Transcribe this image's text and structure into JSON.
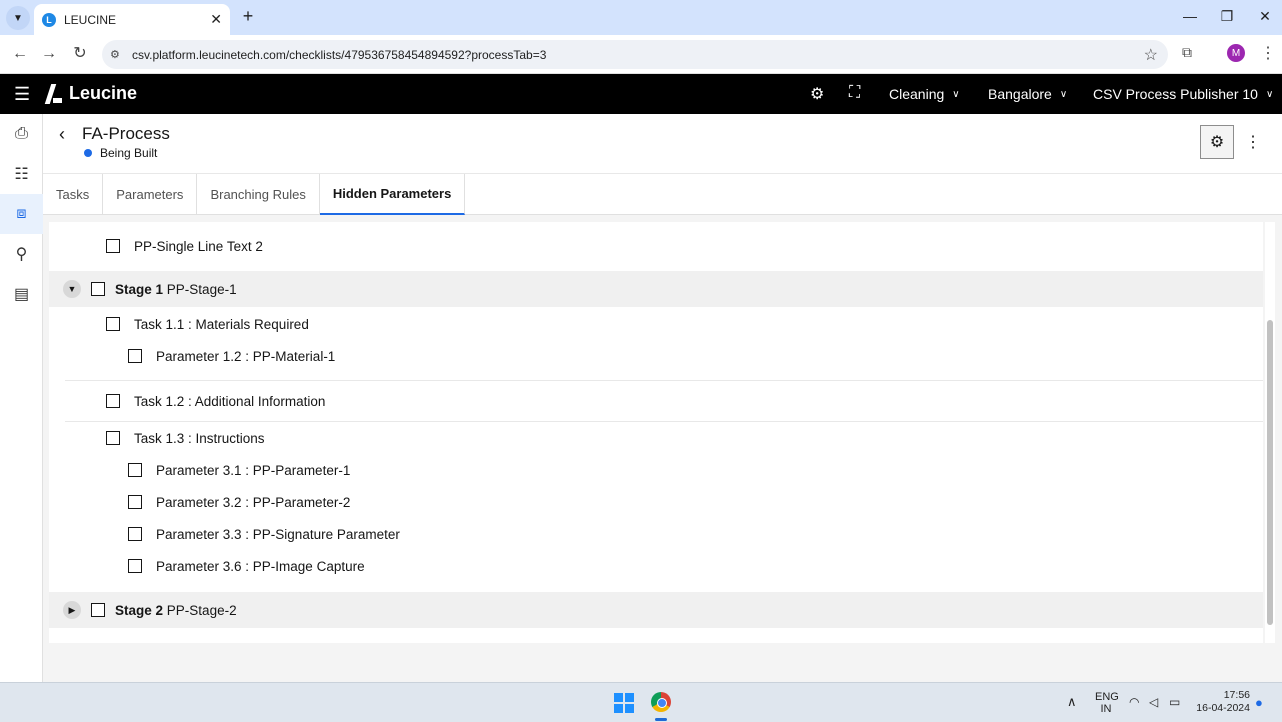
{
  "browser": {
    "tab_title": "LEUCINE",
    "tab_favicon_letter": "L",
    "url": "csv.platform.leucinetech.com/checklists/479536758454894592?processTab=3",
    "profile_initial": "M"
  },
  "header": {
    "brand": "Leucine",
    "facility": "Cleaning",
    "site": "Bangalore",
    "user": "CSV Process Publisher 10"
  },
  "process": {
    "title": "FA-Process",
    "status": "Being Built",
    "status_color": "#1d6ae5"
  },
  "tabs": [
    {
      "label": "Tasks"
    },
    {
      "label": "Parameters"
    },
    {
      "label": "Branching Rules"
    },
    {
      "label": "Hidden Parameters"
    }
  ],
  "tree": {
    "top_item": "PP-Single Line Text 2",
    "stage1": {
      "prefix": "Stage 1",
      "name": "PP-Stage-1"
    },
    "task11": "Task 1.1 : Materials Required",
    "param12": "Parameter 1.2 : PP-Material-1",
    "task12": "Task 1.2 : Additional Information",
    "task13": "Task 1.3 : Instructions",
    "param31": "Parameter 3.1 : PP-Parameter-1",
    "param32": "Parameter 3.2 : PP-Parameter-2",
    "param33": "Parameter 3.3 : PP-Signature Parameter",
    "param36": "Parameter 3.6 : PP-Image Capture",
    "stage2": {
      "prefix": "Stage 2",
      "name": "PP-Stage-2"
    }
  },
  "taskbar": {
    "lang_top": "ENG",
    "lang_bottom": "IN",
    "time": "17:56",
    "date": "16-04-2024"
  },
  "colors": {
    "accent": "#1d6ae5",
    "header_bg": "#000000"
  }
}
